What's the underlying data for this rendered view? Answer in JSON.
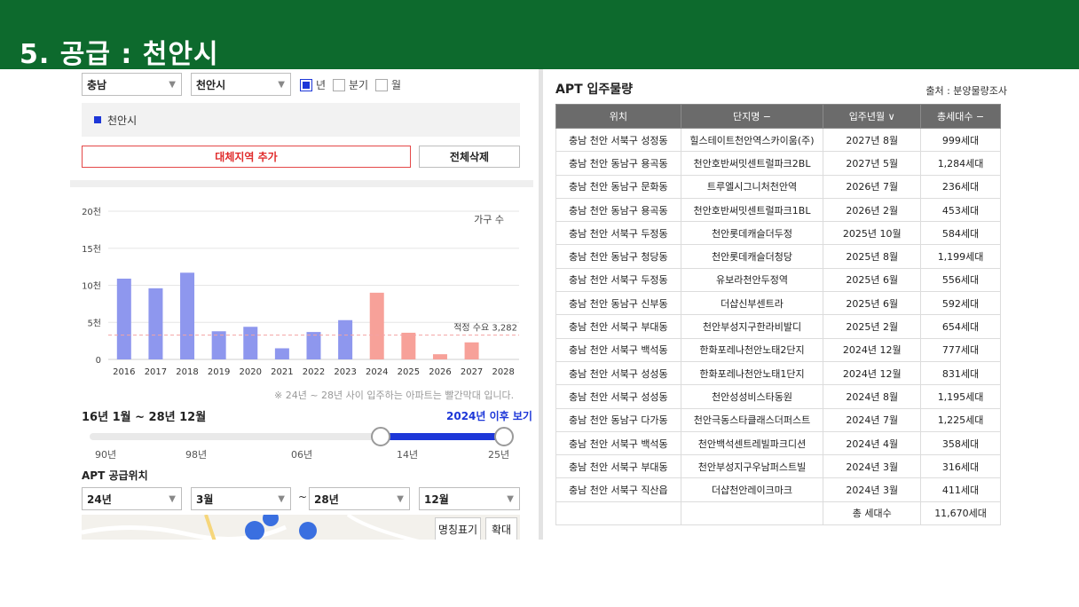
{
  "page": {
    "title": "5. 공급 : 천안시"
  },
  "filters": {
    "province": "충남",
    "city": "천안시",
    "period_options": [
      {
        "label": "년",
        "checked": true
      },
      {
        "label": "분기",
        "checked": false
      },
      {
        "label": "월",
        "checked": false
      }
    ],
    "selected_region": "천안시",
    "add_button": "대체지역 추가",
    "delete_button": "전체삭제"
  },
  "chart_data": {
    "type": "bar",
    "categories": [
      "2016",
      "2017",
      "2018",
      "2019",
      "2020",
      "2021",
      "2022",
      "2023",
      "2024",
      "2025",
      "2026",
      "2027",
      "2028"
    ],
    "values": [
      10900,
      9600,
      11700,
      3800,
      4400,
      1500,
      3700,
      5300,
      9000,
      3600,
      700,
      2300,
      0
    ],
    "ylim": [
      0,
      20000
    ],
    "yticks": [
      {
        "label": "20천",
        "value": 20000
      },
      {
        "label": "15천",
        "value": 15000
      },
      {
        "label": "10천",
        "value": 10000
      },
      {
        "label": "5천",
        "value": 5000
      },
      {
        "label": "0",
        "value": 0
      }
    ],
    "ylabel": "가구 수",
    "threshold": {
      "label": "적정 수요 3,282",
      "value": 3282
    },
    "colors": {
      "past": "#8e97ee",
      "future": "#f7a199",
      "threshold": "#f4a3a3"
    },
    "highlight_from": "2024",
    "grid": true
  },
  "chart_note": "※ 24년 ~ 28년 사이 입주하는 아파트는 빨간막대 입니다.",
  "period_range": "16년 1월 ~ 28년 12월",
  "after_link": "2024년 이후 보기",
  "slider": {
    "labels": [
      "90년",
      "98년",
      "06년",
      "14년",
      "25년"
    ],
    "range_start": "2024",
    "range_end": "2025"
  },
  "supply_location": {
    "title": "APT 공급위치",
    "from_year": "24년",
    "from_month": "3월",
    "to_year": "28년",
    "to_month": "12월",
    "range_sep": "~",
    "name_toggle": "명칭표기",
    "zoom": "확대"
  },
  "apt_table": {
    "title": "APT 입주물량",
    "source": "출처 : 분양물량조사",
    "headers": [
      "위치",
      "단지명 −",
      "입주년월 ∨",
      "총세대수 −"
    ],
    "rows": [
      [
        "충남 천안 서북구 성정동",
        "힐스테이트천안역스카이움(주)",
        "2027년 8월",
        "999세대"
      ],
      [
        "충남 천안 동남구 용곡동",
        "천안호반써밋센트럴파크2BL",
        "2027년 5월",
        "1,284세대"
      ],
      [
        "충남 천안 동남구 문화동",
        "트루엘시그니처천안역",
        "2026년 7월",
        "236세대"
      ],
      [
        "충남 천안 동남구 용곡동",
        "천안호반써밋센트럴파크1BL",
        "2026년 2월",
        "453세대"
      ],
      [
        "충남 천안 서북구 두정동",
        "천안롯데캐슬더두정",
        "2025년 10월",
        "584세대"
      ],
      [
        "충남 천안 동남구 청당동",
        "천안롯데캐슬더청당",
        "2025년 8월",
        "1,199세대"
      ],
      [
        "충남 천안 서북구 두정동",
        "유보라천안두정역",
        "2025년 6월",
        "556세대"
      ],
      [
        "충남 천안 동남구 신부동",
        "더샵신부센트라",
        "2025년 6월",
        "592세대"
      ],
      [
        "충남 천안 서북구 부대동",
        "천안부성지구한라비발디",
        "2025년 2월",
        "654세대"
      ],
      [
        "충남 천안 서북구 백석동",
        "한화포레나천안노태2단지",
        "2024년 12월",
        "777세대"
      ],
      [
        "충남 천안 서북구 성성동",
        "한화포레나천안노태1단지",
        "2024년 12월",
        "831세대"
      ],
      [
        "충남 천안 서북구 성성동",
        "천안성성비스타동원",
        "2024년 8월",
        "1,195세대"
      ],
      [
        "충남 천안 동남구 다가동",
        "천안극동스타클래스더퍼스트",
        "2024년 7월",
        "1,225세대"
      ],
      [
        "충남 천안 서북구 백석동",
        "천안백석센트레빌파크디션",
        "2024년 4월",
        "358세대"
      ],
      [
        "충남 천안 서북구 부대동",
        "천안부성지구우남퍼스트빌",
        "2024년 3월",
        "316세대"
      ],
      [
        "충남 천안 서북구 직산읍",
        "더샵천안레이크마크",
        "2024년 3월",
        "411세대"
      ]
    ],
    "total_label": "총 세대수",
    "total_value": "11,670세대"
  }
}
